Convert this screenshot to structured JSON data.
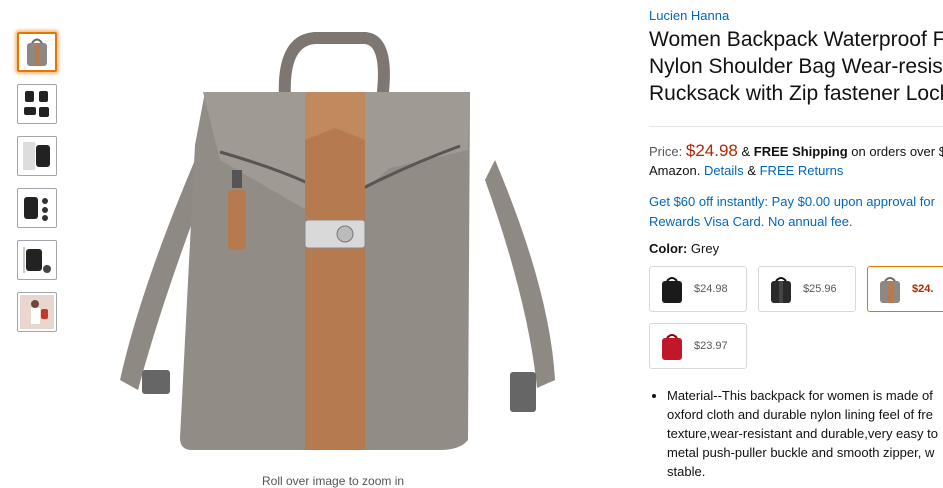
{
  "thumbnails": [
    {
      "name": "grey-backpack",
      "selected": true
    },
    {
      "name": "black-backpack-views",
      "selected": false
    },
    {
      "name": "black-backpack-detail",
      "selected": false
    },
    {
      "name": "black-backpack-features",
      "selected": false
    },
    {
      "name": "black-backpack-size",
      "selected": false
    },
    {
      "name": "model-wearing-backpack",
      "selected": false
    }
  ],
  "main_image": {
    "hint": "Roll over image to zoom in"
  },
  "product": {
    "brand": "Lucien Hanna",
    "title_line1": "Women Backpack Waterproof F",
    "title_line2": "Nylon Shoulder Bag Wear-resis",
    "title_line3": "Rucksack with Zip fastener Lock"
  },
  "pricing": {
    "price_label": "Price:",
    "price": "$24.98",
    "amp": "&",
    "free_shipping": "FREE Shipping",
    "orders_over": "on orders over $",
    "amazon": "Amazon.",
    "details": "Details",
    "amp2": "&",
    "free_returns": "FREE Returns"
  },
  "promo": {
    "line1": "Get $60 off instantly: Pay $0.00 upon approval for",
    "line2": "Rewards Visa Card. No annual fee."
  },
  "color": {
    "label": "Color:",
    "value": "Grey"
  },
  "swatches": [
    {
      "color": "black",
      "price": "$24.98",
      "selected": false
    },
    {
      "color": "black-alt",
      "price": "$25.96",
      "selected": false
    },
    {
      "color": "grey",
      "price": "$24.",
      "selected": true
    },
    {
      "color": "red",
      "price": "$23.97",
      "selected": false
    }
  ],
  "features": [
    "Material--This backpack for women is made of",
    "oxford cloth and durable nylon lining feel of fre",
    "texture,wear-resistant and durable,very easy to",
    "metal push-puller buckle and smooth zipper, w",
    "stable."
  ],
  "colors": {
    "accent": "#e77600",
    "link": "#0066c0",
    "price": "#b12704"
  }
}
